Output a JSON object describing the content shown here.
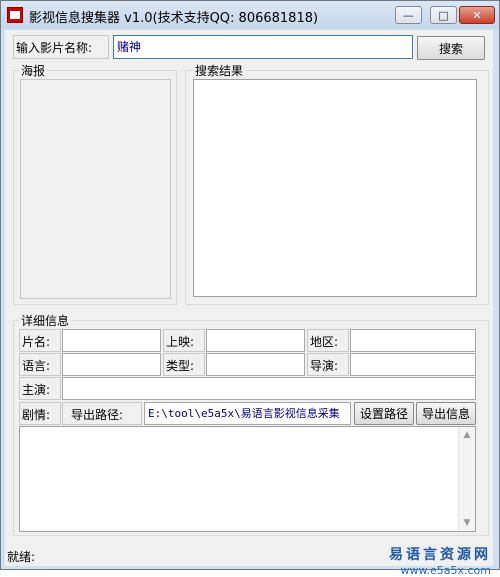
{
  "window": {
    "title": "影视信息搜集器 v1.0(技术支持QQ: 806681818)"
  },
  "search": {
    "label": "输入影片名称:",
    "value": "赌神",
    "button": "搜索"
  },
  "poster": {
    "title": "海报"
  },
  "results": {
    "title": "搜索结果"
  },
  "details": {
    "title": "详细信息",
    "labels": {
      "name": "片名:",
      "release": "上映:",
      "region": "地区:",
      "language": "语言:",
      "genre": "类型:",
      "director": "导演:",
      "cast": "主演:",
      "plot": "剧情:"
    },
    "values": {
      "name": "",
      "release": "",
      "region": "",
      "language": "",
      "genre": "",
      "director": "",
      "cast": ""
    }
  },
  "export": {
    "path_label": "导出路径:",
    "path_value": "E:\\tool\\e5a5x\\易语言影视信息采集",
    "set_path_button": "设置路径",
    "export_button": "导出信息"
  },
  "status": {
    "text": "就绪:"
  },
  "watermark": {
    "site_name": "易语言资源网",
    "url": "www.e5a5x.com"
  }
}
